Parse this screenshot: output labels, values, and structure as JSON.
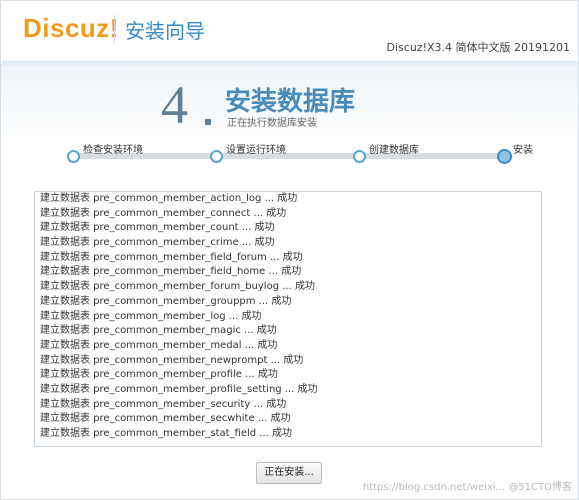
{
  "header": {
    "logo": "Discuz!",
    "title": "安装向导",
    "version": "Discuz!X3.4 简体中文版 20191201"
  },
  "step": {
    "number": "4",
    "title": "安装数据库",
    "subtitle": "正在执行数据库安装"
  },
  "progress": {
    "steps": [
      "检查安装环境",
      "设置运行环境",
      "创建数据库",
      "安装"
    ],
    "active_index": 3
  },
  "log": {
    "lines": [
      "建立数据表 pre_common_member_action_log ... 成功",
      "建立数据表 pre_common_member_connect ... 成功",
      "建立数据表 pre_common_member_count ... 成功",
      "建立数据表 pre_common_member_crime ... 成功",
      "建立数据表 pre_common_member_field_forum ... 成功",
      "建立数据表 pre_common_member_field_home ... 成功",
      "建立数据表 pre_common_member_forum_buylog ... 成功",
      "建立数据表 pre_common_member_grouppm ... 成功",
      "建立数据表 pre_common_member_log ... 成功",
      "建立数据表 pre_common_member_magic ... 成功",
      "建立数据表 pre_common_member_medal ... 成功",
      "建立数据表 pre_common_member_newprompt ... 成功",
      "建立数据表 pre_common_member_profile ... 成功",
      "建立数据表 pre_common_member_profile_setting ... 成功",
      "建立数据表 pre_common_member_security ... 成功",
      "建立数据表 pre_common_member_secwhite ... 成功",
      "建立数据表 pre_common_member_stat_field ... 成功"
    ]
  },
  "button": {
    "label": "正在安装..."
  },
  "watermark": "https://blog.csdn.net/weixi... @51CTO博客",
  "colors": {
    "logo": "#f29b1d",
    "accent": "#3a8ac8",
    "step_number": "#5e7f98"
  }
}
